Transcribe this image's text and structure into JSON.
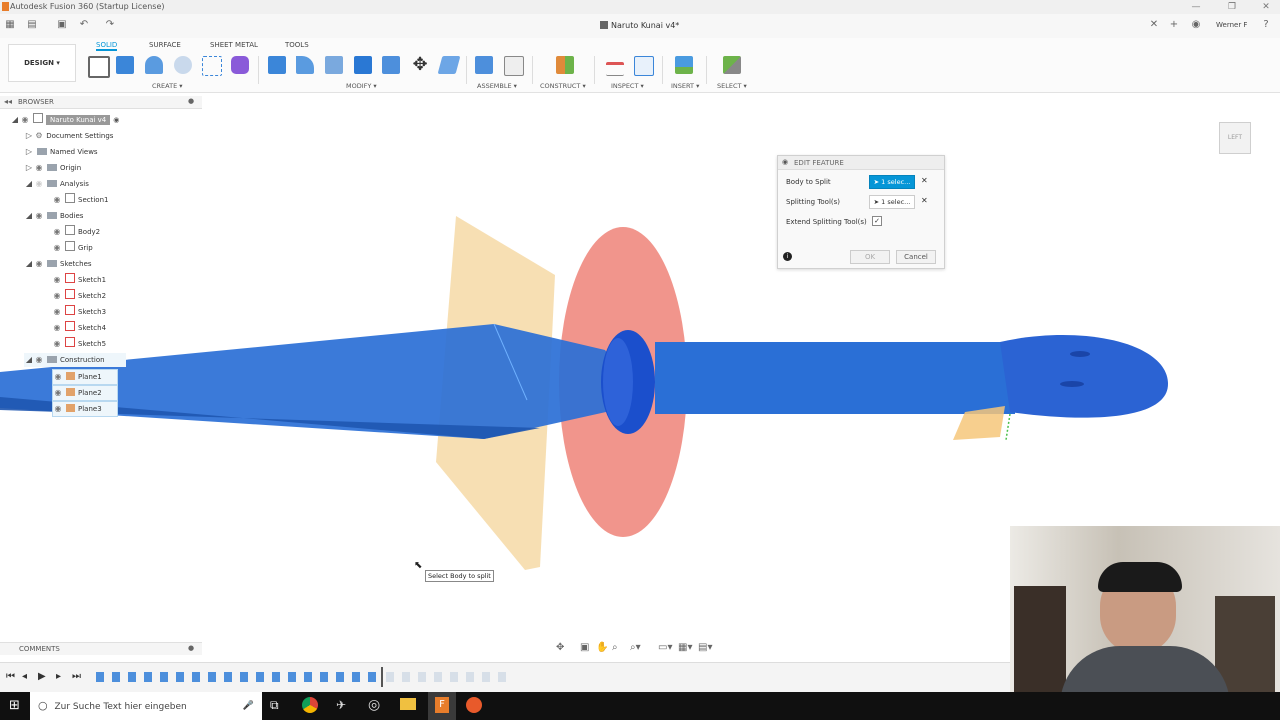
{
  "window": {
    "app_title": "Autodesk Fusion 360 (Startup License)",
    "doc_tab": "Naruto Kunai v4*",
    "user": "Werner F"
  },
  "ribbon": {
    "design_label": "DESIGN",
    "tabs": [
      "SOLID",
      "SURFACE",
      "SHEET METAL",
      "TOOLS"
    ],
    "groups": [
      "CREATE",
      "MODIFY",
      "ASSEMBLE",
      "CONSTRUCT",
      "INSPECT",
      "INSERT",
      "SELECT"
    ]
  },
  "browser": {
    "title": "BROWSER",
    "items": [
      {
        "label": "Naruto Kunai v4",
        "kind": "root"
      },
      {
        "label": "Document Settings",
        "kind": "settings"
      },
      {
        "label": "Named Views",
        "kind": "folder"
      },
      {
        "label": "Origin",
        "kind": "folder"
      },
      {
        "label": "Analysis",
        "kind": "folder"
      },
      {
        "label": "Section1",
        "kind": "section"
      },
      {
        "label": "Bodies",
        "kind": "folder"
      },
      {
        "label": "Body2",
        "kind": "body"
      },
      {
        "label": "Grip",
        "kind": "body"
      },
      {
        "label": "Sketches",
        "kind": "folder"
      },
      {
        "label": "Sketch1",
        "kind": "sketch"
      },
      {
        "label": "Sketch2",
        "kind": "sketch"
      },
      {
        "label": "Sketch3",
        "kind": "sketch"
      },
      {
        "label": "Sketch4",
        "kind": "sketch"
      },
      {
        "label": "Sketch5",
        "kind": "sketch"
      },
      {
        "label": "Construction",
        "kind": "folder"
      },
      {
        "label": "Plane1",
        "kind": "plane"
      },
      {
        "label": "Plane2",
        "kind": "plane"
      },
      {
        "label": "Plane3",
        "kind": "plane"
      }
    ]
  },
  "dialog": {
    "title": "EDIT FEATURE",
    "body_to_split_label": "Body to Split",
    "body_to_split_value": "1 selec...",
    "splitting_tools_label": "Splitting Tool(s)",
    "splitting_tools_value": "1 selec...",
    "extend_label": "Extend Splitting Tool(s)",
    "extend_checked": true,
    "ok_label": "OK",
    "cancel_label": "Cancel"
  },
  "viewcube_label": "LEFT",
  "tooltip": "Select Body to split",
  "comments": {
    "title": "COMMENTS"
  },
  "taskbar": {
    "search_placeholder": "Zur Suche Text hier eingeben"
  },
  "colors": {
    "accent": "#0696d7",
    "body": "#2a6fd6",
    "plane": "#f6d9a6",
    "section": "#f08a80"
  }
}
